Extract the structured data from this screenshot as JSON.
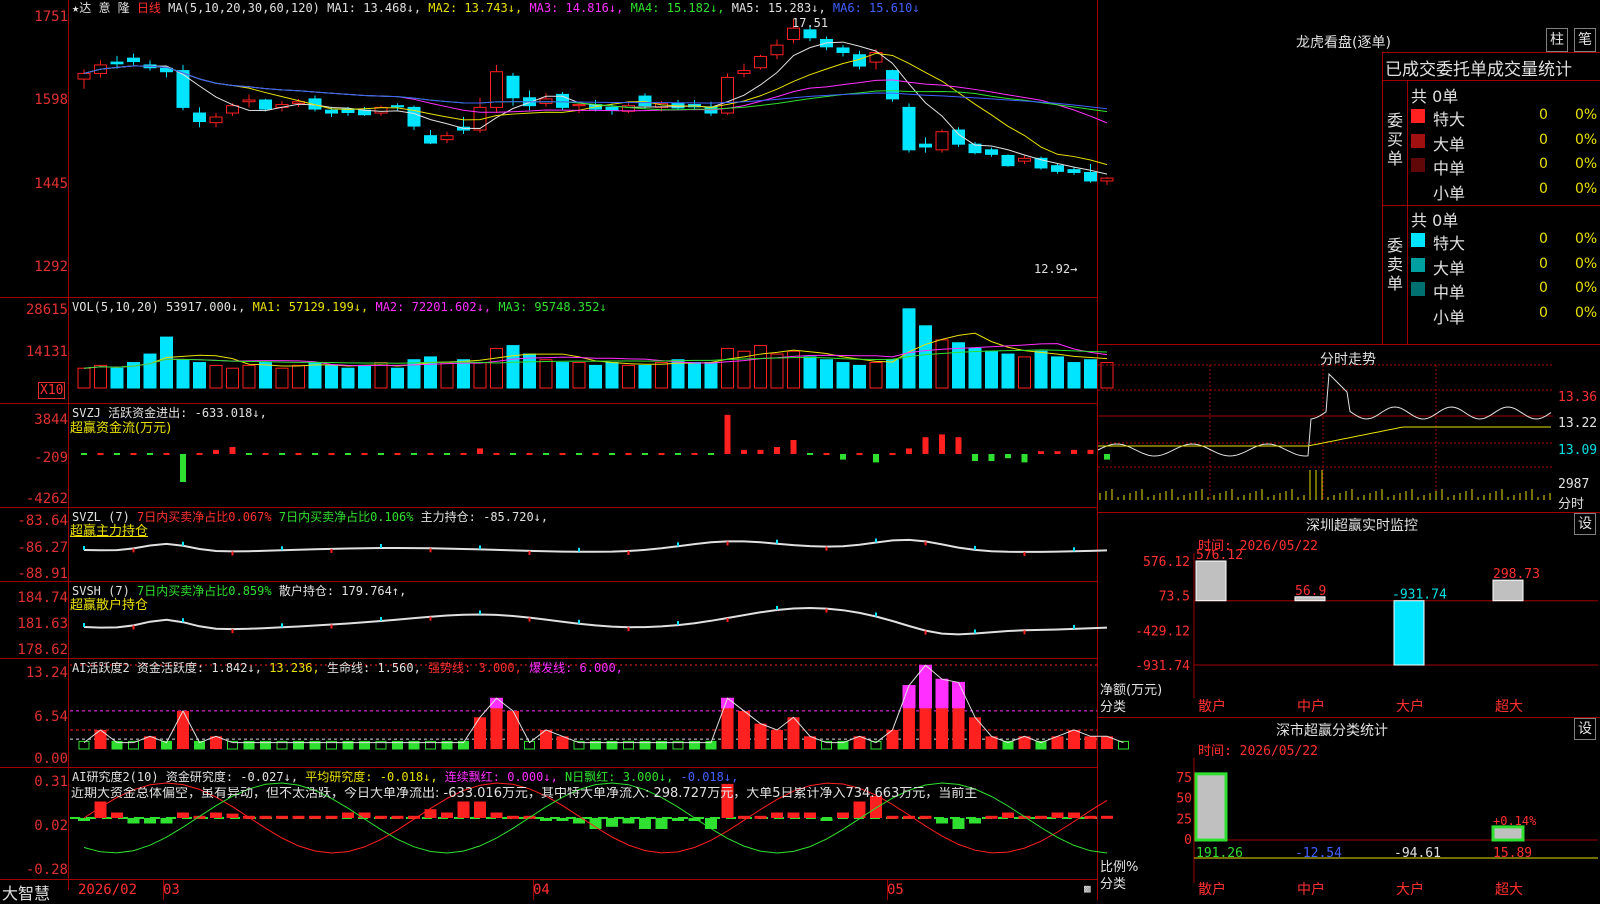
{
  "colors": {
    "up": "#ff2020",
    "down": "#00e5ff",
    "ma1": "#e0e0e0",
    "ma2": "#e8e000",
    "ma3": "#ff30ff",
    "ma4": "#30e030",
    "ma5": "#a0a0a0",
    "ma6": "#4060ff",
    "grid": "#a00000"
  },
  "main": {
    "title": "★达 意 隆",
    "period": "日线",
    "ma_def": "MA(5,10,20,30,60,120)",
    "ma1": "MA1: 13.468↓,",
    "ma2": "MA2: 13.743↓,",
    "ma3": "MA3: 14.816↓,",
    "ma4": "MA4: 15.182↓,",
    "ma5": "MA5: 15.283↓,",
    "ma6": "MA6: 15.610↓",
    "y_ticks": [
      "1751",
      "1598",
      "1445",
      "1292"
    ],
    "high_label": "17.51",
    "low_label": "12.92→"
  },
  "vol": {
    "def": "VOL(5,10,20)",
    "v": "53917.000↓,",
    "ma1": "MA1: 57129.199↓,",
    "ma2": "MA2: 72201.602↓,",
    "ma3": "MA3: 95748.352↓",
    "y_ticks": [
      "28615",
      "14131"
    ],
    "unit": "X10"
  },
  "svzj": {
    "name": "SVZJ",
    "desc": "活跃资金进出: -633.018↓,",
    "sub": "超赢资金流(万元)",
    "y_ticks": [
      "3844",
      "-209",
      "-4262"
    ]
  },
  "svzl": {
    "name": "SVZL (7)",
    "t1": "7日内买卖净占比0.067%",
    "t2": "7日内买卖净占比0.106%",
    "t3": "主力持仓: -85.720↓,",
    "sub": "超赢主力持仓",
    "y_ticks": [
      "-83.64",
      "-86.27",
      "-88.91"
    ]
  },
  "svsh": {
    "name": "SVSH (7)",
    "t1": "7日内买卖净占比0.859%",
    "t2": "散户持仓: 179.764↑,",
    "sub": "超赢散户持仓",
    "y_ticks": [
      "184.74",
      "181.63",
      "178.62"
    ]
  },
  "ai1": {
    "name": "AI活跃度2",
    "t1": "资金活跃度: 1.842↓,",
    "t2": "13.236,",
    "t3": "生命线: 1.560,",
    "t4": "强势线: 3.000,",
    "t5": "爆发线: 6.000,",
    "y_ticks": [
      "13.24",
      "6.54",
      "0.00"
    ]
  },
  "ai2": {
    "name": "AI研究度2(10)",
    "t1": "资金研究度: -0.027↓,",
    "t2": "平均研究度: -0.018↓,",
    "t3": "连续飘红: 0.000↓,",
    "t4": "N日飘红: 3.000↓,",
    "t5": "-0.018↓,",
    "summary": "近期大资金总体偏空，虽有异动，但不太活跃，今日大单净流出: -633.016万元，其中特大单净流入: 298.727万元，大单5日累计净入734.663万元，当前主",
    "y_ticks": [
      "0.31",
      "0.02",
      "-0.28"
    ]
  },
  "footer": {
    "logo": "大智慧",
    "dates": [
      "2026/02",
      "03",
      "04",
      "05"
    ]
  },
  "right": {
    "lhkp_title": "龙虎看盘(逐单)",
    "btn_bar": "柱",
    "btn_pen": "笔",
    "stats_header": "已成交委托单成交量统计",
    "buy_side": "委买单",
    "buy_total": "共 0单",
    "sell_side": "委卖单",
    "sell_total": "共 0单",
    "buy_rows": [
      {
        "label": "特大",
        "n": "0",
        "p": "0%",
        "color": "#ff2020"
      },
      {
        "label": "大单",
        "n": "0",
        "p": "0%",
        "color": "#a01010"
      },
      {
        "label": "中单",
        "n": "0",
        "p": "0%",
        "color": "#600808"
      },
      {
        "label": "小单",
        "n": "0",
        "p": "0%",
        "color": "#000000"
      }
    ],
    "sell_rows": [
      {
        "label": "特大",
        "n": "0",
        "p": "0%",
        "color": "#00e5ff"
      },
      {
        "label": "大单",
        "n": "0",
        "p": "0%",
        "color": "#00a0a0"
      },
      {
        "label": "中单",
        "n": "0",
        "p": "0%",
        "color": "#007070"
      },
      {
        "label": "小单",
        "n": "0",
        "p": "0%",
        "color": "#000000"
      }
    ],
    "intraday_title": "分时走势",
    "intraday_ticks": [
      "13.36",
      "13.22",
      "13.09"
    ],
    "intraday_vol": "2987",
    "intraday_unit": "分时",
    "monitor_title": "深圳超赢实时监控",
    "monitor_btn": "设",
    "monitor_time": "时间: 2026/05/22",
    "monitor_ticks": [
      "576.12",
      "73.5",
      "-429.12",
      "-931.74"
    ],
    "monitor_axis": "净额(万元)",
    "monitor_axis2": "分类",
    "monitor_values": [
      {
        "cat": "散户",
        "v": 576.12,
        "label": "576.12",
        "lc": "#ff3030"
      },
      {
        "cat": "中户",
        "v": 56.9,
        "label": "56.9",
        "lc": "#ff3030"
      },
      {
        "cat": "大户",
        "v": -931.74,
        "label": "-931.74",
        "lc": "#00e0e0"
      },
      {
        "cat": "超大",
        "v": 298.73,
        "label": "298.73",
        "lc": "#ff3030"
      }
    ],
    "class_title": "深市超赢分类统计",
    "class_btn": "设",
    "class_time": "时间: 2026/05/22",
    "class_ticks": [
      "75",
      "50",
      "25",
      "0"
    ],
    "class_axis": "比例%",
    "class_axis2": "分类",
    "class_values": [
      {
        "cat": "散户",
        "v": 191.26,
        "label": "191.26",
        "lc": "#30e030"
      },
      {
        "cat": "中户",
        "v": -12.54,
        "label": "-12.54",
        "lc": "#4060ff"
      },
      {
        "cat": "大户",
        "v": -94.61,
        "label": "-94.61",
        "lc": "#e0e0e0"
      },
      {
        "cat": "超大",
        "v": 15.89,
        "label": "15.89",
        "lc": "#ff3030",
        "extra": "+0.14%"
      }
    ]
  },
  "candles": [
    [
      16.45,
      16.62,
      16.28,
      16.55
    ],
    [
      16.55,
      16.78,
      16.48,
      16.7
    ],
    [
      16.75,
      16.86,
      16.63,
      16.72
    ],
    [
      16.82,
      16.9,
      16.7,
      16.76
    ],
    [
      16.7,
      16.78,
      16.6,
      16.65
    ],
    [
      16.64,
      16.68,
      16.48,
      16.58
    ],
    [
      16.6,
      16.7,
      15.9,
      15.95
    ],
    [
      15.85,
      15.95,
      15.6,
      15.7
    ],
    [
      15.68,
      15.85,
      15.6,
      15.78
    ],
    [
      15.85,
      16.02,
      15.8,
      15.98
    ],
    [
      16.05,
      16.18,
      15.95,
      16.08
    ],
    [
      16.08,
      16.1,
      15.88,
      15.92
    ],
    [
      15.95,
      16.06,
      15.88,
      16.0
    ],
    [
      16.02,
      16.1,
      15.96,
      16.05
    ],
    [
      16.1,
      16.16,
      15.88,
      15.92
    ],
    [
      15.9,
      15.96,
      15.78,
      15.85
    ],
    [
      15.92,
      15.96,
      15.8,
      15.86
    ],
    [
      15.9,
      15.96,
      15.8,
      15.82
    ],
    [
      15.85,
      15.98,
      15.8,
      15.95
    ],
    [
      15.98,
      16.02,
      15.9,
      15.96
    ],
    [
      15.95,
      15.98,
      15.55,
      15.62
    ],
    [
      15.45,
      15.55,
      15.3,
      15.32
    ],
    [
      15.38,
      15.52,
      15.32,
      15.45
    ],
    [
      15.6,
      15.78,
      15.48,
      15.55
    ],
    [
      15.55,
      16.12,
      15.5,
      15.95
    ],
    [
      15.95,
      16.7,
      15.85,
      16.58
    ],
    [
      16.5,
      16.56,
      15.98,
      16.12
    ],
    [
      16.12,
      16.25,
      15.9,
      15.98
    ],
    [
      16.02,
      16.2,
      15.96,
      16.1
    ],
    [
      16.18,
      16.22,
      15.9,
      15.95
    ],
    [
      15.98,
      16.05,
      15.85,
      16.0
    ],
    [
      16.0,
      16.08,
      15.88,
      15.92
    ],
    [
      15.95,
      16.02,
      15.82,
      15.9
    ],
    [
      15.88,
      16.02,
      15.85,
      15.98
    ],
    [
      16.15,
      16.2,
      15.92,
      15.98
    ],
    [
      15.95,
      16.06,
      15.88,
      16.02
    ],
    [
      16.02,
      16.08,
      15.9,
      15.94
    ],
    [
      16.0,
      16.08,
      15.9,
      15.96
    ],
    [
      15.96,
      16.05,
      15.8,
      15.85
    ],
    [
      15.85,
      16.55,
      15.82,
      16.48
    ],
    [
      16.55,
      16.72,
      16.48,
      16.6
    ],
    [
      16.65,
      16.88,
      16.62,
      16.85
    ],
    [
      16.88,
      17.15,
      16.8,
      17.05
    ],
    [
      17.15,
      17.51,
      17.08,
      17.35
    ],
    [
      17.32,
      17.4,
      17.12,
      17.18
    ],
    [
      17.15,
      17.2,
      16.96,
      17.02
    ],
    [
      17.0,
      17.05,
      16.85,
      16.92
    ],
    [
      16.88,
      16.95,
      16.62,
      16.68
    ],
    [
      16.75,
      16.98,
      16.62,
      16.92
    ],
    [
      16.6,
      16.62,
      16.05,
      16.1
    ],
    [
      15.95,
      16.02,
      15.15,
      15.2
    ],
    [
      15.3,
      15.42,
      15.15,
      15.25
    ],
    [
      15.2,
      15.56,
      15.15,
      15.52
    ],
    [
      15.55,
      15.6,
      15.25,
      15.3
    ],
    [
      15.3,
      15.34,
      15.12,
      15.15
    ],
    [
      15.2,
      15.24,
      15.08,
      15.12
    ],
    [
      15.1,
      15.12,
      14.9,
      14.92
    ],
    [
      15.0,
      15.1,
      14.95,
      15.05
    ],
    [
      15.05,
      15.08,
      14.85,
      14.88
    ],
    [
      14.92,
      14.96,
      14.78,
      14.82
    ],
    [
      14.85,
      14.9,
      14.76,
      14.8
    ],
    [
      14.8,
      14.95,
      14.62,
      14.65
    ],
    [
      14.65,
      14.72,
      14.58,
      14.7
    ]
  ],
  "volumes": [
    7,
    8,
    7,
    9,
    12,
    18,
    10,
    9,
    8,
    7,
    8,
    9,
    7,
    8,
    9,
    8,
    7,
    8,
    9,
    7,
    10,
    11,
    9,
    10,
    9,
    14,
    15,
    12,
    10,
    9,
    9,
    8,
    9,
    8,
    8,
    9,
    10,
    9,
    9,
    14,
    13,
    15,
    12,
    13,
    11,
    10,
    9,
    8,
    9,
    10,
    28,
    22,
    17,
    16,
    14,
    13,
    12,
    11,
    13,
    11,
    9,
    10,
    9
  ],
  "svzj_vals": [
    0,
    0,
    0,
    0,
    0,
    0,
    -2,
    0,
    0.3,
    0.5,
    0,
    0,
    0,
    0,
    0,
    0,
    0,
    0,
    0,
    0,
    0,
    0,
    0,
    0,
    0.4,
    0,
    0,
    0,
    0,
    0,
    0,
    0,
    0,
    0,
    0,
    0,
    0,
    0,
    0,
    2.8,
    0.3,
    0.3,
    0.5,
    1.0,
    0,
    0,
    -0.4,
    0,
    -0.6,
    0,
    0.4,
    1.2,
    1.4,
    1.2,
    -0.5,
    -0.5,
    -0.3,
    -0.6,
    0.2,
    0.2,
    0.3,
    0.3,
    -0.4
  ],
  "ai1_vals": [
    1,
    3,
    1,
    1,
    2,
    1,
    6,
    1,
    2,
    1,
    1,
    1,
    1,
    1,
    1,
    1,
    1,
    1,
    1,
    1,
    1,
    1,
    1,
    1,
    5,
    8,
    6,
    1,
    3,
    2,
    1,
    1,
    1,
    1,
    1,
    1,
    1,
    1,
    1,
    8,
    6,
    4,
    3,
    5,
    2,
    1,
    1,
    2,
    1,
    3,
    10,
    13.2,
    11,
    10.5,
    5,
    2,
    1,
    2,
    1,
    2,
    3,
    2,
    2,
    1
  ],
  "ai2_vals": [
    -0.02,
    0.15,
    0.05,
    -0.05,
    -0.05,
    -0.05,
    0.05,
    0.02,
    0.05,
    0.04,
    0.02,
    0.02,
    0.02,
    0.02,
    0.02,
    0.02,
    0.05,
    0.05,
    0.02,
    0.02,
    0.02,
    0.08,
    0.05,
    0.15,
    0.15,
    0.05,
    0.02,
    0.02,
    -0.02,
    -0.02,
    -0.05,
    -0.1,
    -0.08,
    -0.05,
    -0.1,
    -0.1,
    -0.02,
    -0.02,
    -0.1,
    0.31,
    0.02,
    0.02,
    0.05,
    0.05,
    0.05,
    0.0,
    0.05,
    0.15,
    0.2,
    0.02,
    0.02,
    0.02,
    -0.05,
    -0.1,
    -0.05,
    0.02,
    0.05,
    0.02,
    0.02,
    0.05,
    0.05,
    0.02,
    0.02
  ]
}
